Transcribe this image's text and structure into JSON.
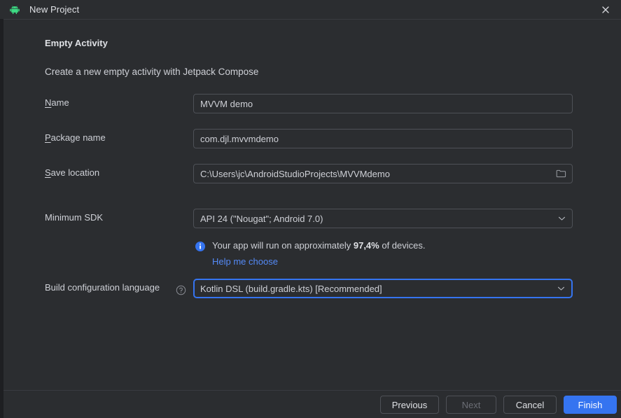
{
  "window": {
    "title": "New Project",
    "app_icon": "android-robot-icon",
    "close_icon": "close-icon"
  },
  "dialog": {
    "heading": "Empty Activity",
    "subheading": "Create a new empty activity with Jetpack Compose"
  },
  "form": {
    "fields": [
      {
        "label": "Name",
        "mnemonic": "N",
        "value": "MVVM demo",
        "type": "text",
        "name": "project-name"
      },
      {
        "label": "Package name",
        "mnemonic": "P",
        "value": "com.djl.mvvmdemo",
        "type": "text",
        "name": "package-name"
      },
      {
        "label": "Save location",
        "mnemonic": "S",
        "value": "C:\\Users\\jc\\AndroidStudioProjects\\MVVMdemo",
        "type": "text-with-browse",
        "browse_icon": "folder-icon",
        "name": "save-location"
      }
    ],
    "minimum_sdk": {
      "label": "Minimum SDK",
      "value": "API 24 (\"Nougat\"; Android 7.0)",
      "arrow_icon": "chevron-down-icon"
    },
    "build_language": {
      "label": "Build configuration language",
      "help_icon": "help-circle-icon",
      "value": "Kotlin DSL (build.gradle.kts) [Recommended]",
      "arrow_icon": "chevron-down-icon",
      "focused": true
    }
  },
  "info": {
    "icon": "info-circle-icon",
    "text_before": "Your app will run on approximately ",
    "percent": "97,4%",
    "text_after": " of devices.",
    "link": "Help me choose"
  },
  "footer": {
    "buttons": [
      {
        "label": "Previous",
        "name": "previous-button",
        "style": "default",
        "enabled": true
      },
      {
        "label": "Next",
        "name": "next-button",
        "style": "disabled",
        "enabled": false
      },
      {
        "label": "Cancel",
        "name": "cancel-button",
        "style": "default",
        "enabled": true
      },
      {
        "label": "Finish",
        "name": "finish-button",
        "style": "primary",
        "enabled": true
      }
    ]
  },
  "colors": {
    "background": "#2b2d30",
    "accent_blue": "#3574f0",
    "link_blue": "#548af7",
    "android_green": "#3ddc84",
    "border": "#4e5157"
  }
}
